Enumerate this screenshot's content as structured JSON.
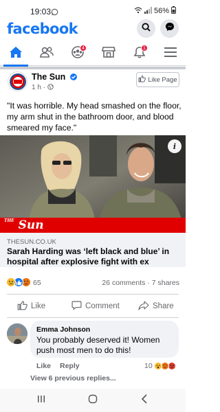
{
  "status_bar": {
    "time": "19:03",
    "battery": "56%"
  },
  "brand": {
    "logo": "facebook"
  },
  "nav": {
    "tabs": [
      {
        "name": "home",
        "active": true
      },
      {
        "name": "friends"
      },
      {
        "name": "groups",
        "badge": "4"
      },
      {
        "name": "marketplace"
      },
      {
        "name": "notifications",
        "badge": "1"
      },
      {
        "name": "menu"
      }
    ]
  },
  "post": {
    "page_name": "The Sun",
    "time": "1 h",
    "like_page_label": "Like Page",
    "caption": "\"It was horrible. My head smashed on the floor, my arm shut in the bathroom door, and blood smeared my face.\"",
    "image_brand": "Sun",
    "image_brand_small": "THE",
    "link": {
      "domain": "THESUN.CO.UK",
      "title": "Sarah Harding was ‘left black and blue’ in hospital after explosive fight with ex"
    },
    "reactions": {
      "count": "65",
      "types": [
        "sad",
        "like",
        "angry"
      ]
    },
    "comments_shares": "26 comments · 7 shares",
    "actions": {
      "like": "Like",
      "comment": "Comment",
      "share": "Share"
    }
  },
  "comment": {
    "author": "Emma Johnson",
    "text": "You probably deserved it! Women push most men to do this!",
    "like_label": "Like",
    "reply_label": "Reply",
    "reaction_count": "10",
    "view_previous": "View 6 previous replies..."
  },
  "colors": {
    "brand_blue": "#1877f2",
    "badge_red": "#e41e3f",
    "sun_red": "#e00000"
  }
}
